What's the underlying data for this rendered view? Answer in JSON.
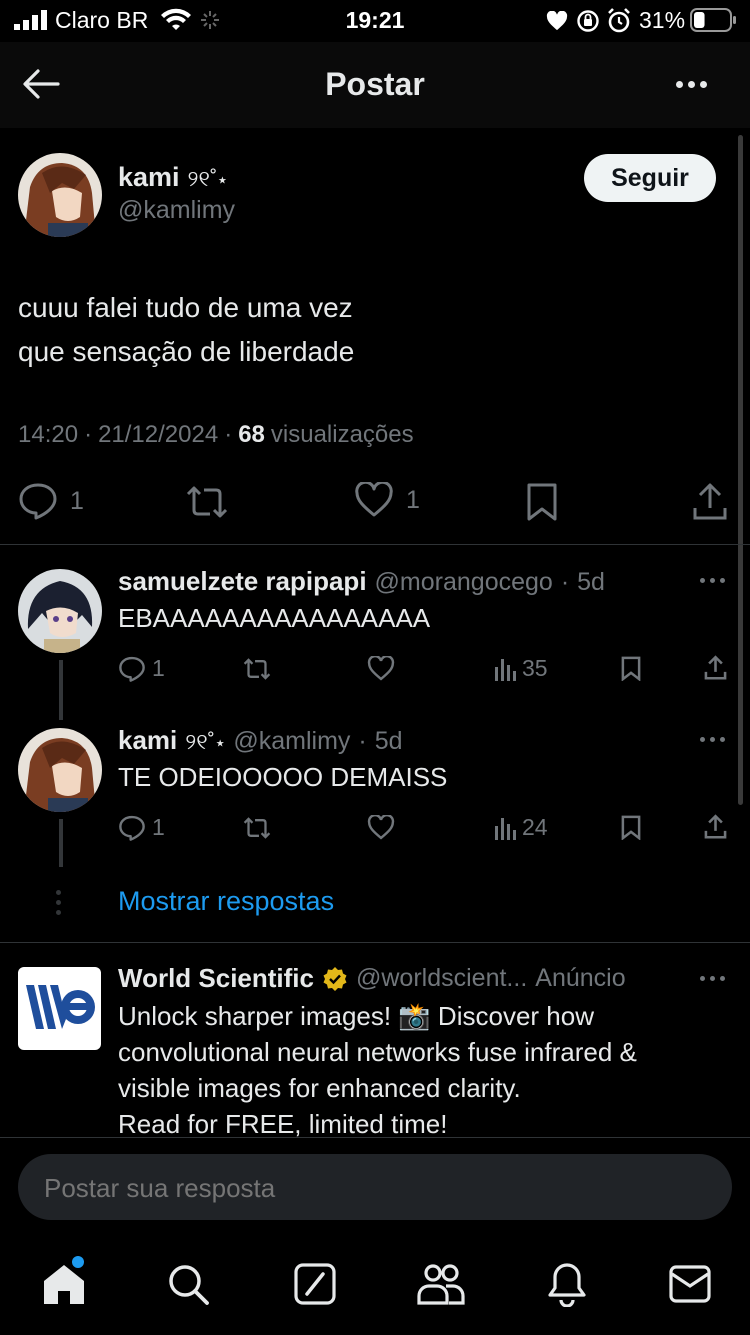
{
  "status_bar": {
    "carrier": "Claro BR",
    "time": "19:21",
    "battery_pct": "31%",
    "battery_level": 0.31
  },
  "header": {
    "title": "Postar"
  },
  "post": {
    "author_name": "kami",
    "author_decoration": "୨୧˚⋆",
    "author_handle": "@kamlimy",
    "follow_label": "Seguir",
    "text_line1": "cuuu falei tudo de uma vez",
    "text_line2": "que sensação de liberdade",
    "time": "14:20",
    "date": "21/12/2024",
    "views_count": "68",
    "views_label": "visualizações",
    "replies": "1",
    "likes": "1"
  },
  "replies": [
    {
      "name": "samuelzete rapipapi",
      "handle": "@morangocego",
      "age": "5d",
      "text": "EBAAAAAAAAAAAAAAAA",
      "replies": "1",
      "views": "35"
    },
    {
      "name": "kami",
      "decoration": "୨୧˚⋆",
      "handle": "@kamlimy",
      "age": "5d",
      "text": "TE ODEIOOOOO DEMAISS",
      "replies": "1",
      "views": "24"
    }
  ],
  "show_replies_label": "Mostrar respostas",
  "ad": {
    "name": "World Scientific",
    "handle": "@worldscient...",
    "label": "Anúncio",
    "line1": "Unlock sharper images! 📸 Discover how",
    "line2": "convolutional neural networks fuse infrared &",
    "line3": "visible images for enhanced clarity.",
    "line4": "Read for FREE, limited time!"
  },
  "reply_input": {
    "placeholder": "Postar sua resposta"
  },
  "colors": {
    "accent": "#1d9bf0",
    "verified": "#e2b719",
    "background": "#000000"
  },
  "icons": [
    "home-icon",
    "search-icon",
    "grok-icon",
    "communities-icon",
    "notifications-icon",
    "messages-icon"
  ]
}
